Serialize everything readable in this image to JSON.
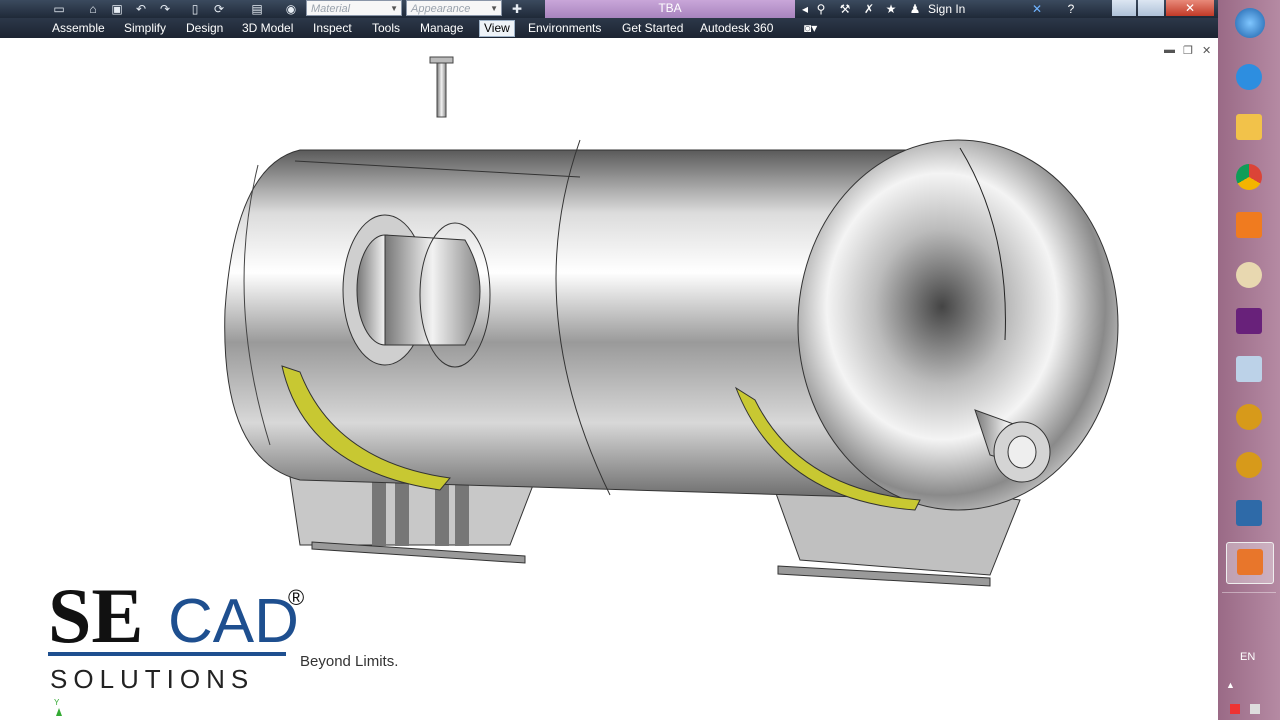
{
  "window": {
    "document_title": "TBA",
    "sign_in": "Sign In"
  },
  "quick_access": {
    "material_placeholder": "Material",
    "appearance_placeholder": "Appearance"
  },
  "ribbon": {
    "tabs": [
      "Assemble",
      "Simplify",
      "Design",
      "3D Model",
      "Inspect",
      "Tools",
      "Manage",
      "View",
      "Environments",
      "Get Started",
      "Autodesk 360"
    ],
    "active_tab": "View"
  },
  "logo": {
    "brand_se": "SE",
    "brand_cad": "CAD",
    "reg": "®",
    "subtitle": "SOLUTIONS",
    "tagline": "Beyond Limits."
  },
  "taskbar": {
    "icons": [
      "windows-start-icon",
      "ie-icon",
      "file-explorer-icon",
      "chrome-icon",
      "media-player-icon",
      "paint-icon",
      "visual-studio-icon",
      "calculator-icon",
      "app-icon-1",
      "app-icon-2",
      "storage-icon",
      "inventor-icon"
    ],
    "language": "EN"
  },
  "colors": {
    "accent_orange": "#ff8a1a",
    "ribbon_dark": "#1f2938",
    "title_purple": "#b38fc8",
    "taskbar": "#a77996",
    "saddle_yellow": "#c8c832"
  }
}
